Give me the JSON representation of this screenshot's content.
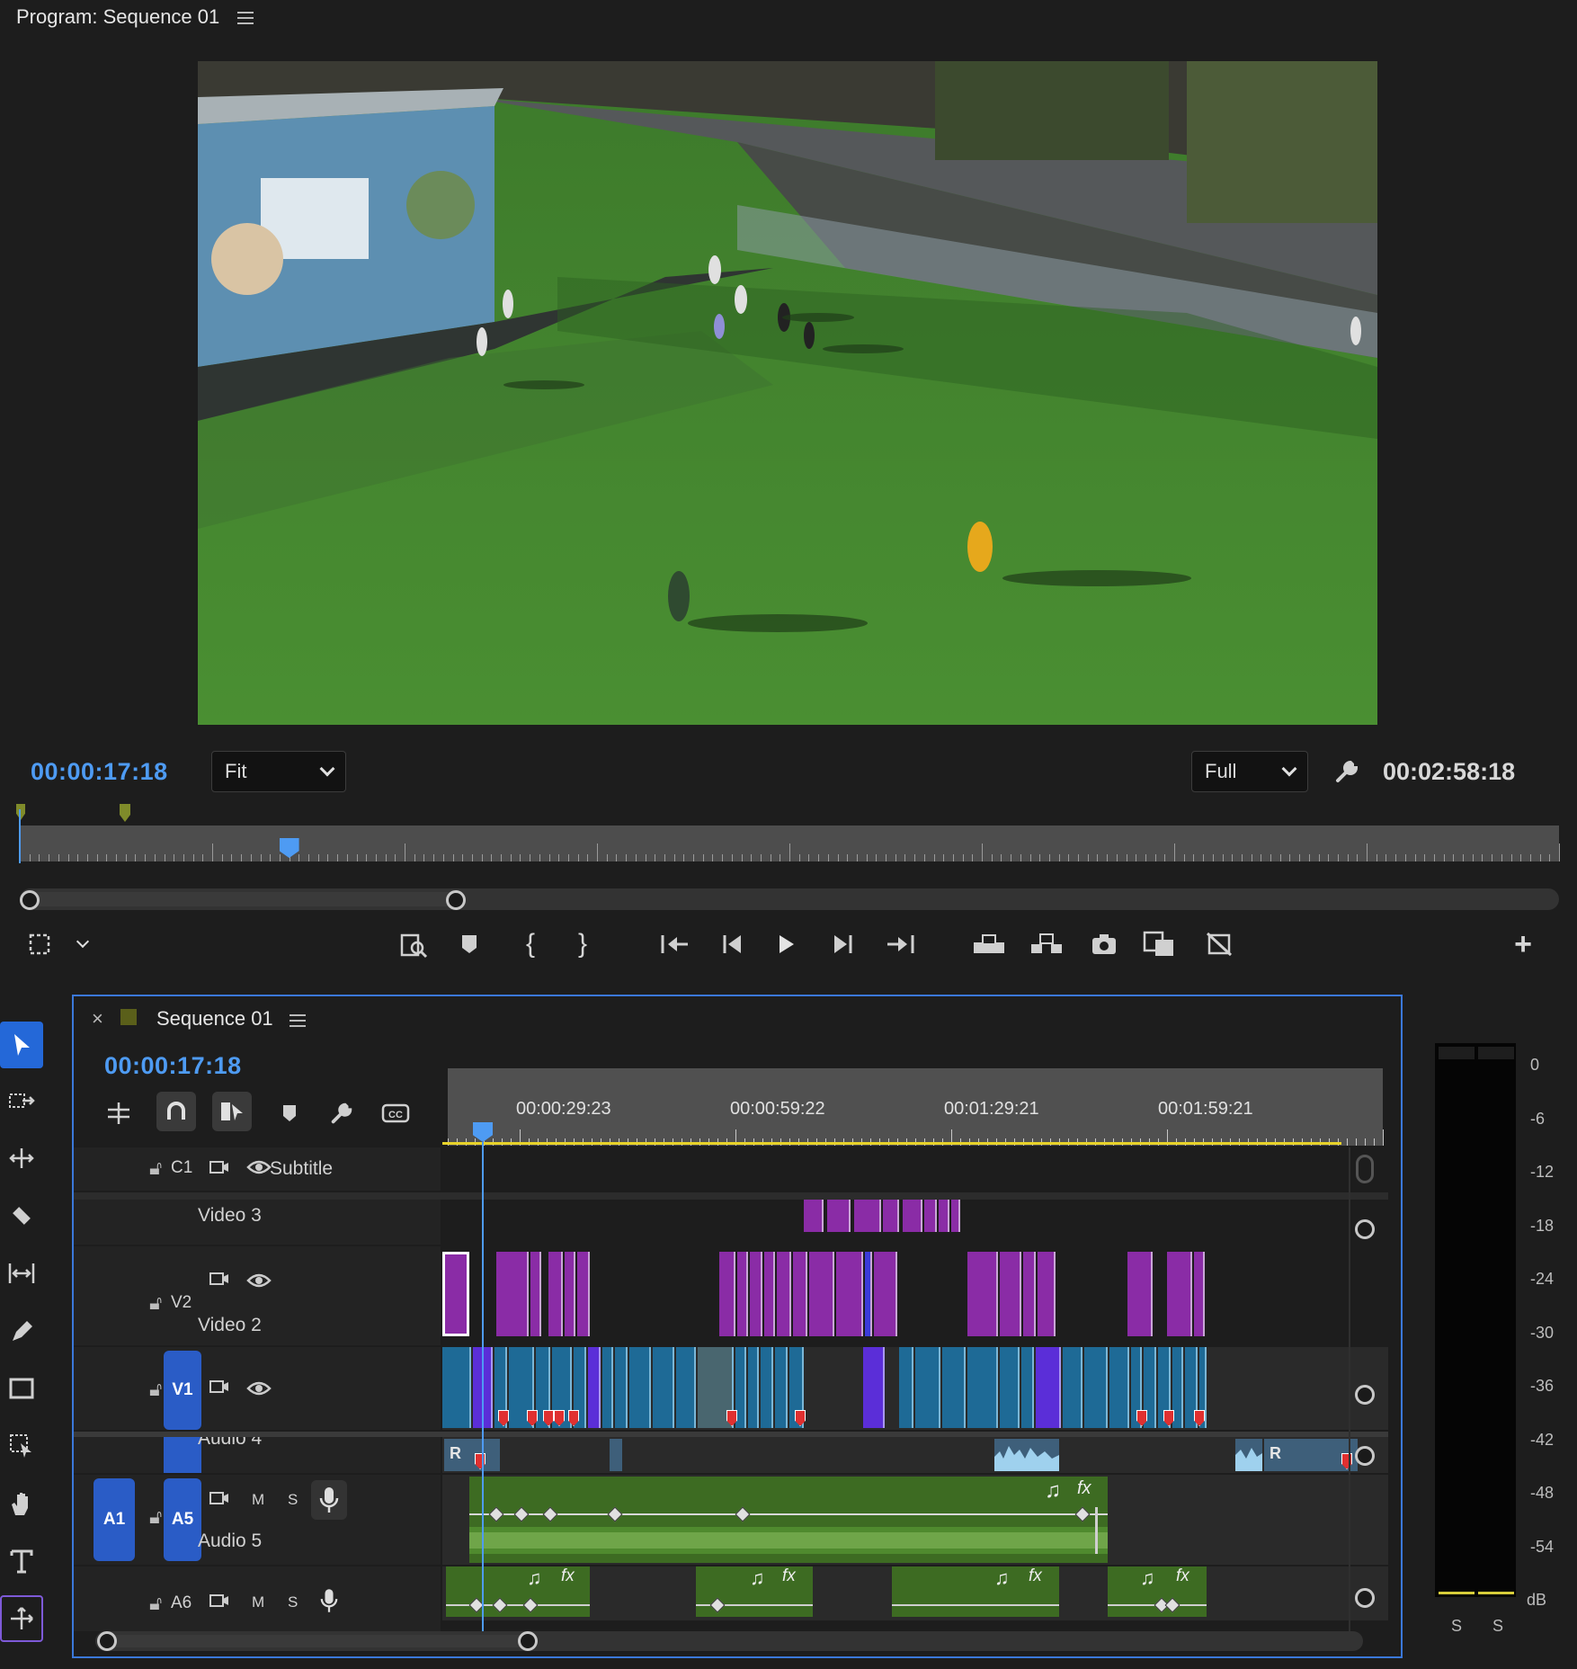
{
  "program": {
    "title": "Program: Sequence 01",
    "current_timecode": "00:00:17:18",
    "fit_label": "Fit",
    "resolution_label": "Full",
    "duration_timecode": "00:02:58:18",
    "playhead_position": 0.175,
    "zoom_range": [
      0.0,
      0.29
    ],
    "transport": {
      "icons": [
        "marker-icon",
        "mark-in-icon",
        "mark-out-icon",
        "go-to-in-icon",
        "step-back-icon",
        "play-icon",
        "step-forward-icon",
        "go-to-out-icon",
        "lift-icon",
        "extract-icon",
        "export-frame-icon",
        "comparison-view-icon",
        "proxy-toggle-icon"
      ],
      "add_label": "+"
    }
  },
  "timeline": {
    "tab_title": "Sequence 01",
    "close_label": "×",
    "timecode": "00:00:17:18",
    "ruler_labels": [
      "00:00:29:23",
      "00:00:59:22",
      "00:01:29:21",
      "00:01:59:21"
    ],
    "tracks": {
      "c1": {
        "id": "C1",
        "name": "Subtitle"
      },
      "v3": {
        "name": "Video 3"
      },
      "v2": {
        "id": "V2",
        "name": "Video 2"
      },
      "v1": {
        "id": "V1"
      },
      "a4": {
        "name": "Audio 4"
      },
      "a5": {
        "source": "A1",
        "id": "A5",
        "name": "Audio 5",
        "mute": "M",
        "solo": "S"
      },
      "a6": {
        "id": "A6",
        "mute": "M",
        "solo": "S"
      }
    },
    "clip_badge": "R",
    "fx_label": "fx"
  },
  "meter": {
    "scale": [
      "0",
      "-6",
      "-12",
      "-18",
      "-24",
      "-30",
      "-36",
      "-42",
      "-48",
      "-54",
      "dB"
    ],
    "solo_labels": [
      "S",
      "S"
    ]
  },
  "colors": {
    "accent_blue": "#4e9bf3",
    "video_purple": "#8a2ca6",
    "video_blue": "#1e6a96",
    "audio_green": "#3d6b22",
    "marker_red": "#e03030"
  }
}
